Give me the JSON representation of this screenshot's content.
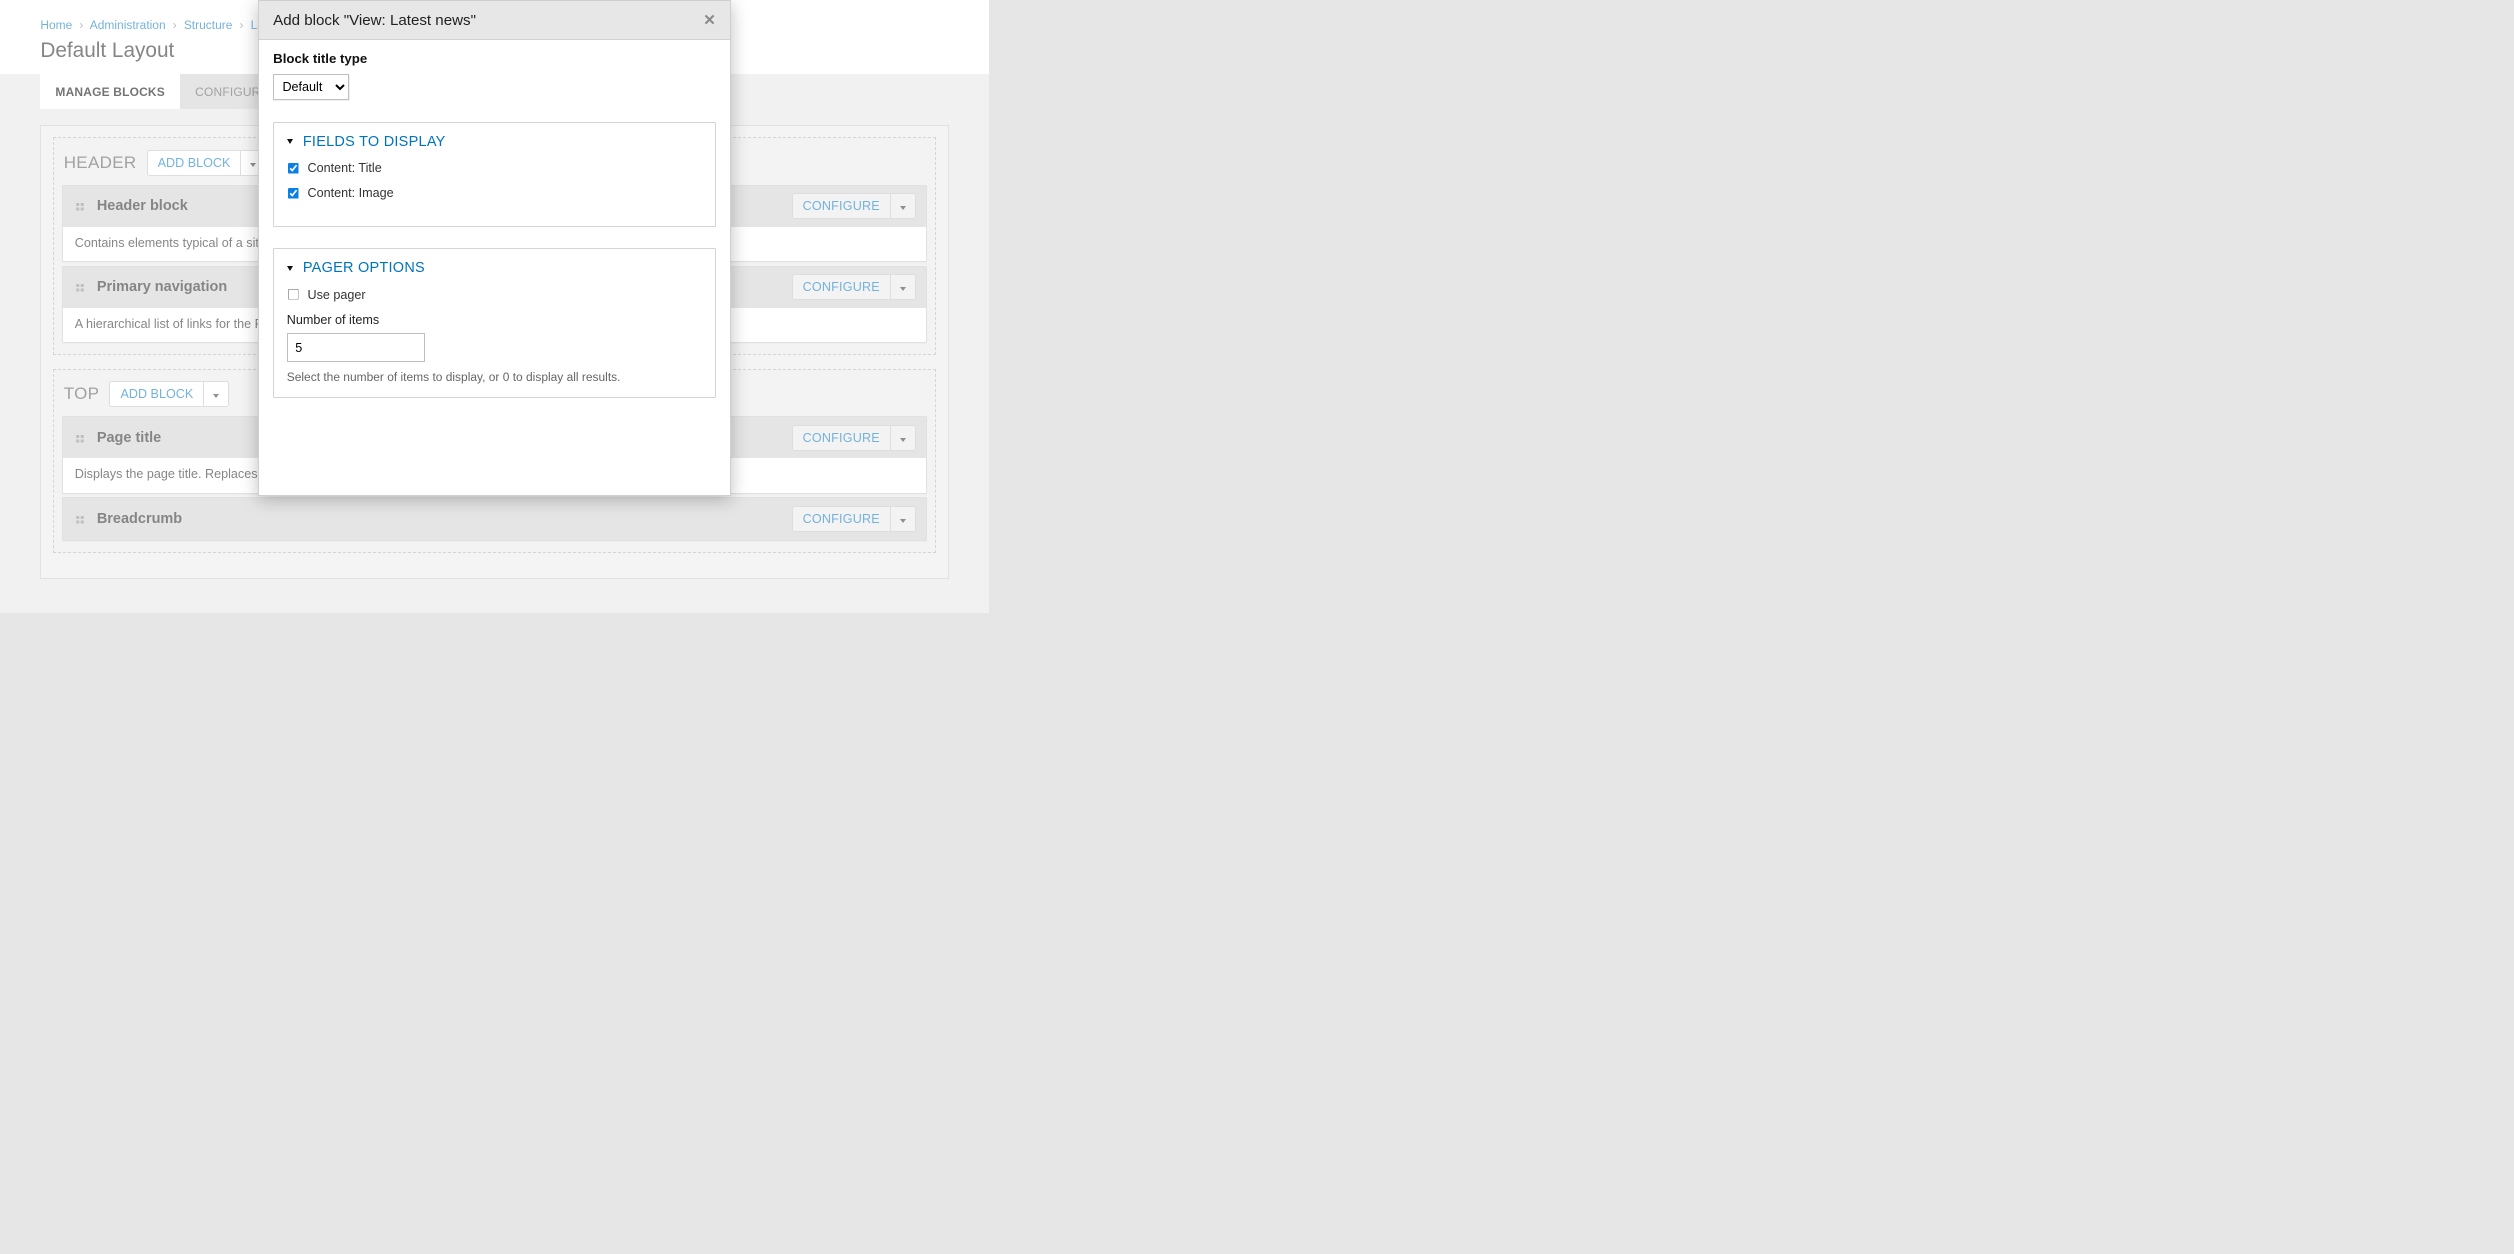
{
  "breadcrumb": [
    {
      "label": "Home"
    },
    {
      "label": "Administration"
    },
    {
      "label": "Structure"
    },
    {
      "label": "Layouts"
    }
  ],
  "page_title": "Default Layout",
  "tabs": [
    {
      "label": "MANAGE BLOCKS",
      "active": true
    },
    {
      "label": "CONFIGURE",
      "active": false
    }
  ],
  "add_block_label": "ADD BLOCK",
  "configure_label": "CONFIGURE",
  "regions": [
    {
      "name": "HEADER",
      "blocks": [
        {
          "title": "Header block",
          "desc": "Contains elements typical of a site h"
        },
        {
          "title": "Primary navigation",
          "desc": "A hierarchical list of links for the Pri"
        }
      ]
    },
    {
      "name": "TOP",
      "blocks": [
        {
          "title": "Page title",
          "desc": "Displays the page title. Replaces the"
        },
        {
          "title": "Breadcrumb",
          "desc": ""
        }
      ]
    }
  ],
  "dialog": {
    "title": "Add block \"View: Latest news\"",
    "block_title_type_label": "Block title type",
    "block_title_type_value": "Default",
    "fields_section": "FIELDS TO DISPLAY",
    "fields": [
      {
        "label": "Content: Title",
        "checked": true
      },
      {
        "label": "Content: Image",
        "checked": true
      }
    ],
    "pager_section": "PAGER OPTIONS",
    "use_pager_label": "Use pager",
    "use_pager_checked": false,
    "num_items_label": "Number of items",
    "num_items_value": "5",
    "num_items_help": "Select the number of items to display, or 0 to display all results."
  }
}
